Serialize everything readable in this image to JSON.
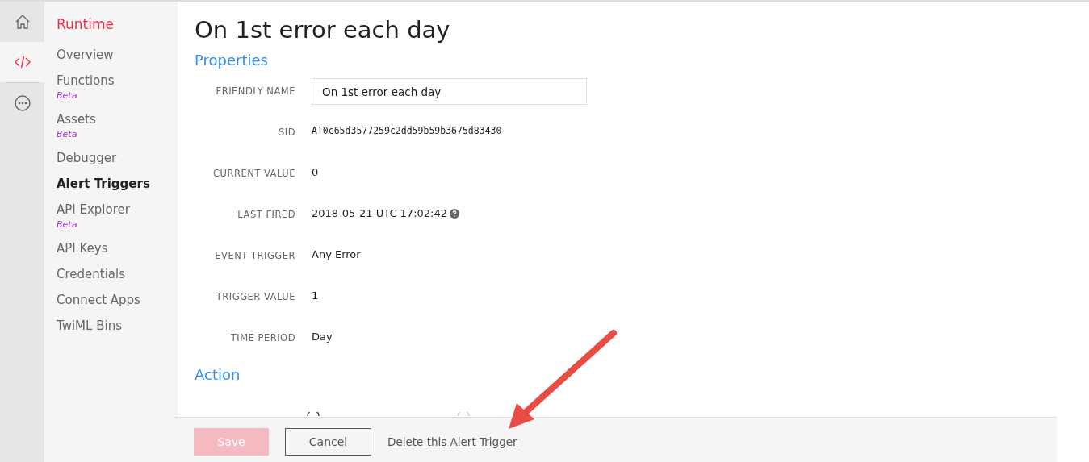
{
  "rail": [
    {
      "kind": "home",
      "selected": false
    },
    {
      "kind": "code",
      "selected": true
    },
    {
      "kind": "more",
      "selected": false
    }
  ],
  "sidebar": {
    "title": "Runtime",
    "items": [
      {
        "label": "Overview",
        "beta": false,
        "selected": false
      },
      {
        "label": "Functions",
        "beta": "Beta",
        "selected": false
      },
      {
        "label": "Assets",
        "beta": "Beta",
        "selected": false
      },
      {
        "label": "Debugger",
        "beta": false,
        "selected": false
      },
      {
        "label": "Alert Triggers",
        "beta": false,
        "selected": true
      },
      {
        "label": "API Explorer",
        "beta": "Beta",
        "selected": false
      },
      {
        "label": "API Keys",
        "beta": false,
        "selected": false
      },
      {
        "label": "Credentials",
        "beta": false,
        "selected": false
      },
      {
        "label": "Connect Apps",
        "beta": false,
        "selected": false
      },
      {
        "label": "TwiML Bins",
        "beta": false,
        "selected": false
      }
    ]
  },
  "page_title": "On 1st error each day",
  "properties": {
    "heading": "Properties",
    "fields": [
      {
        "kind": "input",
        "label": "FRIENDLY NAME",
        "value": "On 1st error each day"
      },
      {
        "kind": "mono",
        "label": "SID",
        "value": "AT0c65d3577259c2dd59b59b3675d83430"
      },
      {
        "kind": "text",
        "label": "CURRENT VALUE",
        "value": "0"
      },
      {
        "kind": "help",
        "label": "LAST FIRED",
        "value": "2018-05-21 UTC 17:02:42"
      },
      {
        "kind": "text",
        "label": "EVENT TRIGGER",
        "value": "Any Error"
      },
      {
        "kind": "text",
        "label": "TRIGGER VALUE",
        "value": "1"
      },
      {
        "kind": "text",
        "label": "TIME PERIOD",
        "value": "Day"
      }
    ]
  },
  "action": {
    "heading": "Action",
    "radios": [
      {
        "kind": "radio"
      },
      {
        "kind": "radio"
      }
    ]
  },
  "footer": {
    "save": {
      "label": "Save",
      "disabled": true
    },
    "cancel": "Cancel",
    "delete_link": "Delete this Alert Trigger"
  }
}
